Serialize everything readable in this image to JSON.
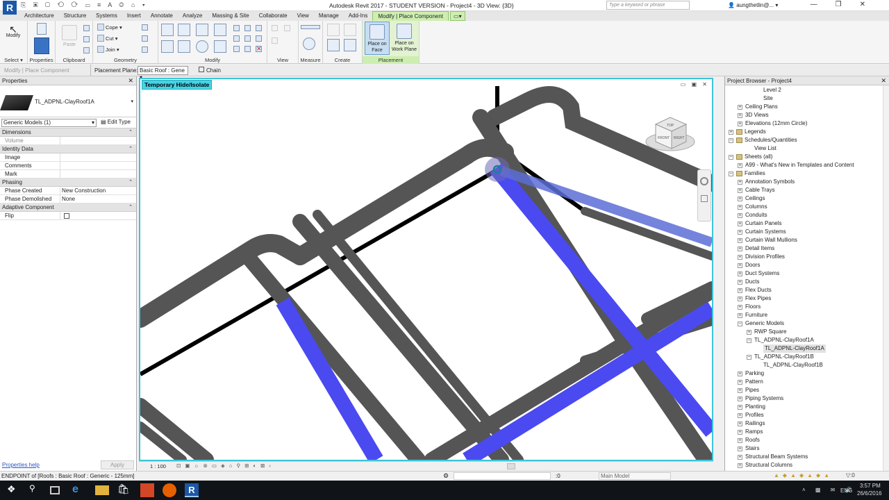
{
  "app": {
    "logo": "R",
    "title": "Autodesk Revit 2017 - STUDENT VERSION -    Project4 - 3D View: {3D}",
    "search_placeholder": "Type a keyword or phrase",
    "user": "aungthetlin@...",
    "quick_access": "⎘ ▣ ▢ ⟲ ⟳ ▭ ≡ A ◎ ⌂ ▾"
  },
  "ribbon_tabs": [
    "Architecture",
    "Structure",
    "Systems",
    "Insert",
    "Annotate",
    "Analyze",
    "Massing & Site",
    "Collaborate",
    "View",
    "Manage",
    "Add-Ins",
    "Modify | Place Component"
  ],
  "ribbon": {
    "modify_label": "Modify",
    "select_label": "Select ▾",
    "properties_label": "Properties",
    "paste_label": "Paste",
    "clipboard_label": "Clipboard",
    "cope_label": "Cope ▾",
    "cut_label": "Cut ▾",
    "join_label": "Join ▾",
    "geometry_label": "Geometry",
    "modify_panel_label": "Modify",
    "view_label": "View",
    "measure_label": "Measure",
    "create_label": "Create",
    "place_on_face": "Place on Face",
    "place_on_work_plane": "Place on Work Plane",
    "placement_label": "Placement"
  },
  "options_bar": {
    "context": "Modify | Place Component",
    "placement_plane_label": "Placement Plane:",
    "placement_plane_value": "Basic Roof : Gene",
    "chain_label": "Chain"
  },
  "properties": {
    "title": "Properties",
    "family_name": "TL_ADPNL-ClayRoof1A",
    "type_selector": "Generic Models (1)",
    "edit_type": "Edit Type",
    "sections": [
      {
        "name": "Dimensions",
        "rows": [
          {
            "k": "Volume",
            "v": "",
            "dim": true
          }
        ]
      },
      {
        "name": "Identity Data",
        "rows": [
          {
            "k": "Image",
            "v": ""
          },
          {
            "k": "Comments",
            "v": ""
          },
          {
            "k": "Mark",
            "v": ""
          }
        ]
      },
      {
        "name": "Phasing",
        "rows": [
          {
            "k": "Phase Created",
            "v": "New Construction"
          },
          {
            "k": "Phase Demolished",
            "v": "None"
          }
        ]
      },
      {
        "name": "Adaptive Component",
        "rows": [
          {
            "k": "Flip",
            "v": "checkbox"
          }
        ]
      }
    ],
    "help_link": "Properties help",
    "apply": "Apply"
  },
  "viewport": {
    "badge": "Temporary Hide/Isolate",
    "scale": "1 : 100",
    "window_controls": "▭ ▣ ✕",
    "view_tools": "⊡ ▣ ☼ ⊛ ▭ ◈ ⌂ ⚲ ⊞ ◐ ⊠ ‹"
  },
  "cube_faces": [
    "TOP",
    "FRONT",
    "RIGHT"
  ],
  "browser": {
    "title": "Project Browser - Project4",
    "items": [
      {
        "label": "Level 2",
        "indent": 3,
        "exp": ""
      },
      {
        "label": "Site",
        "indent": 3,
        "exp": ""
      },
      {
        "label": "Ceiling Plans",
        "indent": 1,
        "exp": "+"
      },
      {
        "label": "3D Views",
        "indent": 1,
        "exp": "+"
      },
      {
        "label": "Elevations (12mm Circle)",
        "indent": 1,
        "exp": "+"
      },
      {
        "label": "Legends",
        "indent": 0,
        "exp": "+",
        "icon": true
      },
      {
        "label": "Schedules/Quantities",
        "indent": 0,
        "exp": "−",
        "icon": true
      },
      {
        "label": "View List",
        "indent": 2,
        "exp": ""
      },
      {
        "label": "Sheets (all)",
        "indent": 0,
        "exp": "−",
        "icon": true
      },
      {
        "label": "A99 - What's New in Templates and Content",
        "indent": 1,
        "exp": "+"
      },
      {
        "label": "Families",
        "indent": 0,
        "exp": "−",
        "icon": true
      },
      {
        "label": "Annotation Symbols",
        "indent": 1,
        "exp": "+"
      },
      {
        "label": "Cable Trays",
        "indent": 1,
        "exp": "+"
      },
      {
        "label": "Ceilings",
        "indent": 1,
        "exp": "+"
      },
      {
        "label": "Columns",
        "indent": 1,
        "exp": "+"
      },
      {
        "label": "Conduits",
        "indent": 1,
        "exp": "+"
      },
      {
        "label": "Curtain Panels",
        "indent": 1,
        "exp": "+"
      },
      {
        "label": "Curtain Systems",
        "indent": 1,
        "exp": "+"
      },
      {
        "label": "Curtain Wall Mullions",
        "indent": 1,
        "exp": "+"
      },
      {
        "label": "Detail Items",
        "indent": 1,
        "exp": "+"
      },
      {
        "label": "Division Profiles",
        "indent": 1,
        "exp": "+"
      },
      {
        "label": "Doors",
        "indent": 1,
        "exp": "+"
      },
      {
        "label": "Duct Systems",
        "indent": 1,
        "exp": "+"
      },
      {
        "label": "Ducts",
        "indent": 1,
        "exp": "+"
      },
      {
        "label": "Flex Ducts",
        "indent": 1,
        "exp": "+"
      },
      {
        "label": "Flex Pipes",
        "indent": 1,
        "exp": "+"
      },
      {
        "label": "Floors",
        "indent": 1,
        "exp": "+"
      },
      {
        "label": "Furniture",
        "indent": 1,
        "exp": "+"
      },
      {
        "label": "Generic Models",
        "indent": 1,
        "exp": "−"
      },
      {
        "label": "RWP Square",
        "indent": 2,
        "exp": "+"
      },
      {
        "label": "TL_ADPNL-ClayRoof1A",
        "indent": 2,
        "exp": "−"
      },
      {
        "label": "TL_ADPNL-ClayRoof1A",
        "indent": 3,
        "exp": "",
        "selected": true
      },
      {
        "label": "TL_ADPNL-ClayRoof1B",
        "indent": 2,
        "exp": "−"
      },
      {
        "label": "TL_ADPNL-ClayRoof1B",
        "indent": 3,
        "exp": ""
      },
      {
        "label": "Parking",
        "indent": 1,
        "exp": "+"
      },
      {
        "label": "Pattern",
        "indent": 1,
        "exp": "+"
      },
      {
        "label": "Pipes",
        "indent": 1,
        "exp": "+"
      },
      {
        "label": "Piping Systems",
        "indent": 1,
        "exp": "+"
      },
      {
        "label": "Planting",
        "indent": 1,
        "exp": "+"
      },
      {
        "label": "Profiles",
        "indent": 1,
        "exp": "+"
      },
      {
        "label": "Railings",
        "indent": 1,
        "exp": "+"
      },
      {
        "label": "Ramps",
        "indent": 1,
        "exp": "+"
      },
      {
        "label": "Roofs",
        "indent": 1,
        "exp": "+"
      },
      {
        "label": "Stairs",
        "indent": 1,
        "exp": "+"
      },
      {
        "label": "Structural Beam Systems",
        "indent": 1,
        "exp": "+"
      },
      {
        "label": "Structural Columns",
        "indent": 1,
        "exp": "+"
      }
    ]
  },
  "status": {
    "text": "ENDPOINT  of [Roofs : Basic Roof : Generic - 125mm]",
    "coord": ":0",
    "model": "Main Model"
  },
  "taskbar": {
    "lang": "ENG",
    "time": "3:57 PM",
    "date": "26/6/2016"
  },
  "colors": {
    "accent_teal": "#3cc4d8",
    "selection_blue": "#4a4af0",
    "roof_gray": "#555555",
    "ribbon_context_green": "#cdeeb0"
  }
}
